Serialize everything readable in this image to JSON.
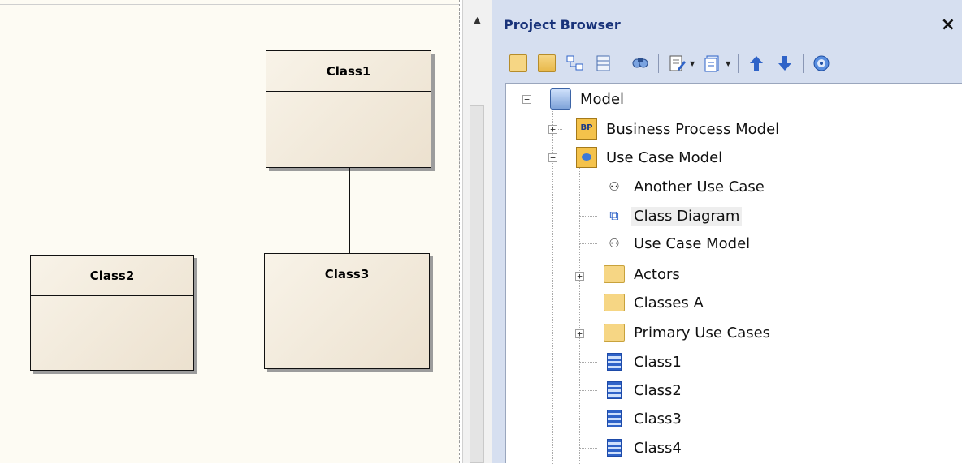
{
  "diagram": {
    "classes": [
      {
        "id": "class1",
        "name": "Class1"
      },
      {
        "id": "class2",
        "name": "Class2"
      },
      {
        "id": "class3",
        "name": "Class3"
      }
    ]
  },
  "scrollbar": {
    "up_arrow": "▲"
  },
  "project_browser": {
    "title": "Project Browser",
    "close_label": "×",
    "toolbar": [
      {
        "name": "new-package-icon"
      },
      {
        "name": "new-view-icon"
      },
      {
        "name": "new-diagram-icon"
      },
      {
        "name": "new-element-icon"
      },
      {
        "name": "find-icon"
      },
      {
        "name": "edit-properties-icon"
      },
      {
        "name": "generate-documentation-icon"
      },
      {
        "name": "move-up-icon"
      },
      {
        "name": "move-down-icon"
      },
      {
        "name": "help-icon"
      }
    ],
    "tree": {
      "root": "Model",
      "items": [
        {
          "label": "Business Process Model",
          "icon": "business-process-model-icon"
        },
        {
          "label": "Use Case Model",
          "icon": "use-case-model-icon"
        },
        {
          "label": "Another Use Case",
          "icon": "use-case-diagram-icon"
        },
        {
          "label": "Class Diagram",
          "icon": "class-diagram-icon"
        },
        {
          "label": "Use Case Model",
          "icon": "use-case-diagram-icon"
        },
        {
          "label": "Actors",
          "icon": "folder-icon"
        },
        {
          "label": "Classes A",
          "icon": "folder-icon"
        },
        {
          "label": "Primary Use Cases",
          "icon": "folder-icon"
        },
        {
          "label": "Class1",
          "icon": "class-icon"
        },
        {
          "label": "Class2",
          "icon": "class-icon"
        },
        {
          "label": "Class3",
          "icon": "class-icon"
        },
        {
          "label": "Class4",
          "icon": "class-icon"
        }
      ]
    }
  }
}
